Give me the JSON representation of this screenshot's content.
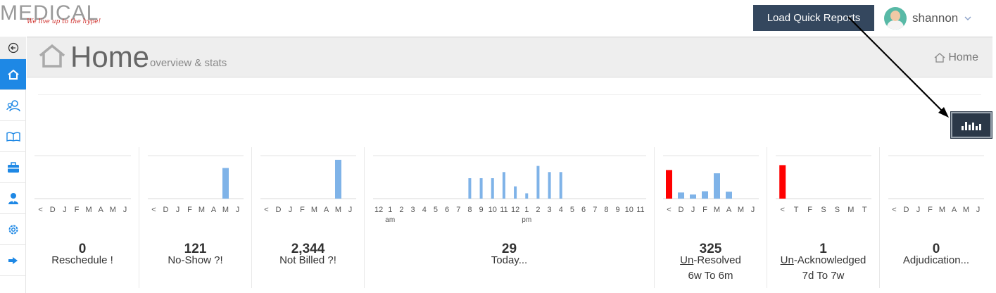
{
  "brand": {
    "name": "MEDICAL",
    "tagline": "We live up to the hype!"
  },
  "topbar": {
    "quick_reports_label": "Load Quick Reports",
    "username": "shannon"
  },
  "sidebar": {
    "items": [
      {
        "name": "back",
        "icon": "back-arrow-icon"
      },
      {
        "name": "home",
        "icon": "home-icon",
        "active": true
      },
      {
        "name": "patients",
        "icon": "users-icon"
      },
      {
        "name": "library",
        "icon": "book-icon"
      },
      {
        "name": "work",
        "icon": "briefcase-icon"
      },
      {
        "name": "staff",
        "icon": "user-tie-icon"
      },
      {
        "name": "settings",
        "icon": "gear-icon"
      },
      {
        "name": "logout",
        "icon": "sign-out-icon"
      }
    ]
  },
  "header": {
    "title": "Home",
    "subtitle": "overview & stats",
    "breadcrumb": "Home"
  },
  "colors": {
    "accent": "#1e88e5",
    "bar": "#7fb3e8",
    "alert": "#ff0000",
    "button": "#34475e"
  },
  "panels": [
    {
      "id": "reschedule",
      "value": "0",
      "label": "Reschedule !",
      "label2": "",
      "ticks": [
        "<",
        "D",
        "J",
        "F",
        "M",
        "A",
        "M",
        "J"
      ],
      "bars": [
        0,
        0,
        0,
        0,
        0,
        0,
        0,
        0
      ],
      "bar_colors": []
    },
    {
      "id": "no-show",
      "value": "121",
      "label": "No-Show ?!",
      "label2": "",
      "ticks": [
        "<",
        "D",
        "J",
        "F",
        "M",
        "A",
        "M",
        "J"
      ],
      "bars": [
        0,
        0,
        0,
        0,
        0,
        0,
        0.75,
        0
      ],
      "bar_colors": []
    },
    {
      "id": "not-billed",
      "value": "2,344",
      "label": "Not Billed ?!",
      "label2": "",
      "ticks": [
        "<",
        "D",
        "J",
        "F",
        "M",
        "A",
        "M",
        "J"
      ],
      "bars": [
        0,
        0,
        0,
        0,
        0,
        0,
        0.95,
        0
      ],
      "bar_colors": []
    },
    {
      "id": "today",
      "value": "29",
      "label": "Today...",
      "label2": "",
      "ticks": [
        "12",
        "1",
        "2",
        "3",
        "4",
        "5",
        "6",
        "7",
        "8",
        "9",
        "10",
        "11",
        "12",
        "1",
        "2",
        "3",
        "4",
        "5",
        "6",
        "7",
        "8",
        "9",
        "10",
        "11"
      ],
      "tick_sub": {
        "am": "am",
        "pm": "pm"
      },
      "bars": [
        0,
        0,
        0,
        0,
        0,
        0,
        0,
        0,
        0.5,
        0.5,
        0.5,
        0.65,
        0.3,
        0.13,
        0.8,
        0.65,
        0.65,
        0,
        0,
        0,
        0,
        0,
        0,
        0
      ],
      "bar_colors": []
    },
    {
      "id": "unresolved",
      "value": "325",
      "label_prefix": "Un",
      "label": "-Resolved",
      "label2": "6w To 6m",
      "ticks": [
        "<",
        "D",
        "J",
        "F",
        "M",
        "A",
        "M",
        "J"
      ],
      "bars": [
        0.7,
        0.15,
        0.1,
        0.18,
        0.62,
        0.17,
        0,
        0
      ],
      "bar_colors": [
        "#ff0000"
      ]
    },
    {
      "id": "unacknowledged",
      "value": "1",
      "label_prefix": "Un",
      "label": "-Acknowledged",
      "label2": "7d To 7w",
      "ticks": [
        "<",
        "T",
        "F",
        "S",
        "S",
        "M",
        "T"
      ],
      "bars": [
        0.82,
        0,
        0,
        0,
        0,
        0,
        0
      ],
      "bar_colors": [
        "#ff0000"
      ]
    },
    {
      "id": "adjudication",
      "value": "0",
      "label": "Adjudication...",
      "label2": "",
      "ticks": [
        "<",
        "D",
        "J",
        "F",
        "M",
        "A",
        "M",
        "J"
      ],
      "bars": [
        0,
        0,
        0,
        0,
        0,
        0,
        0,
        0
      ],
      "bar_colors": []
    }
  ]
}
